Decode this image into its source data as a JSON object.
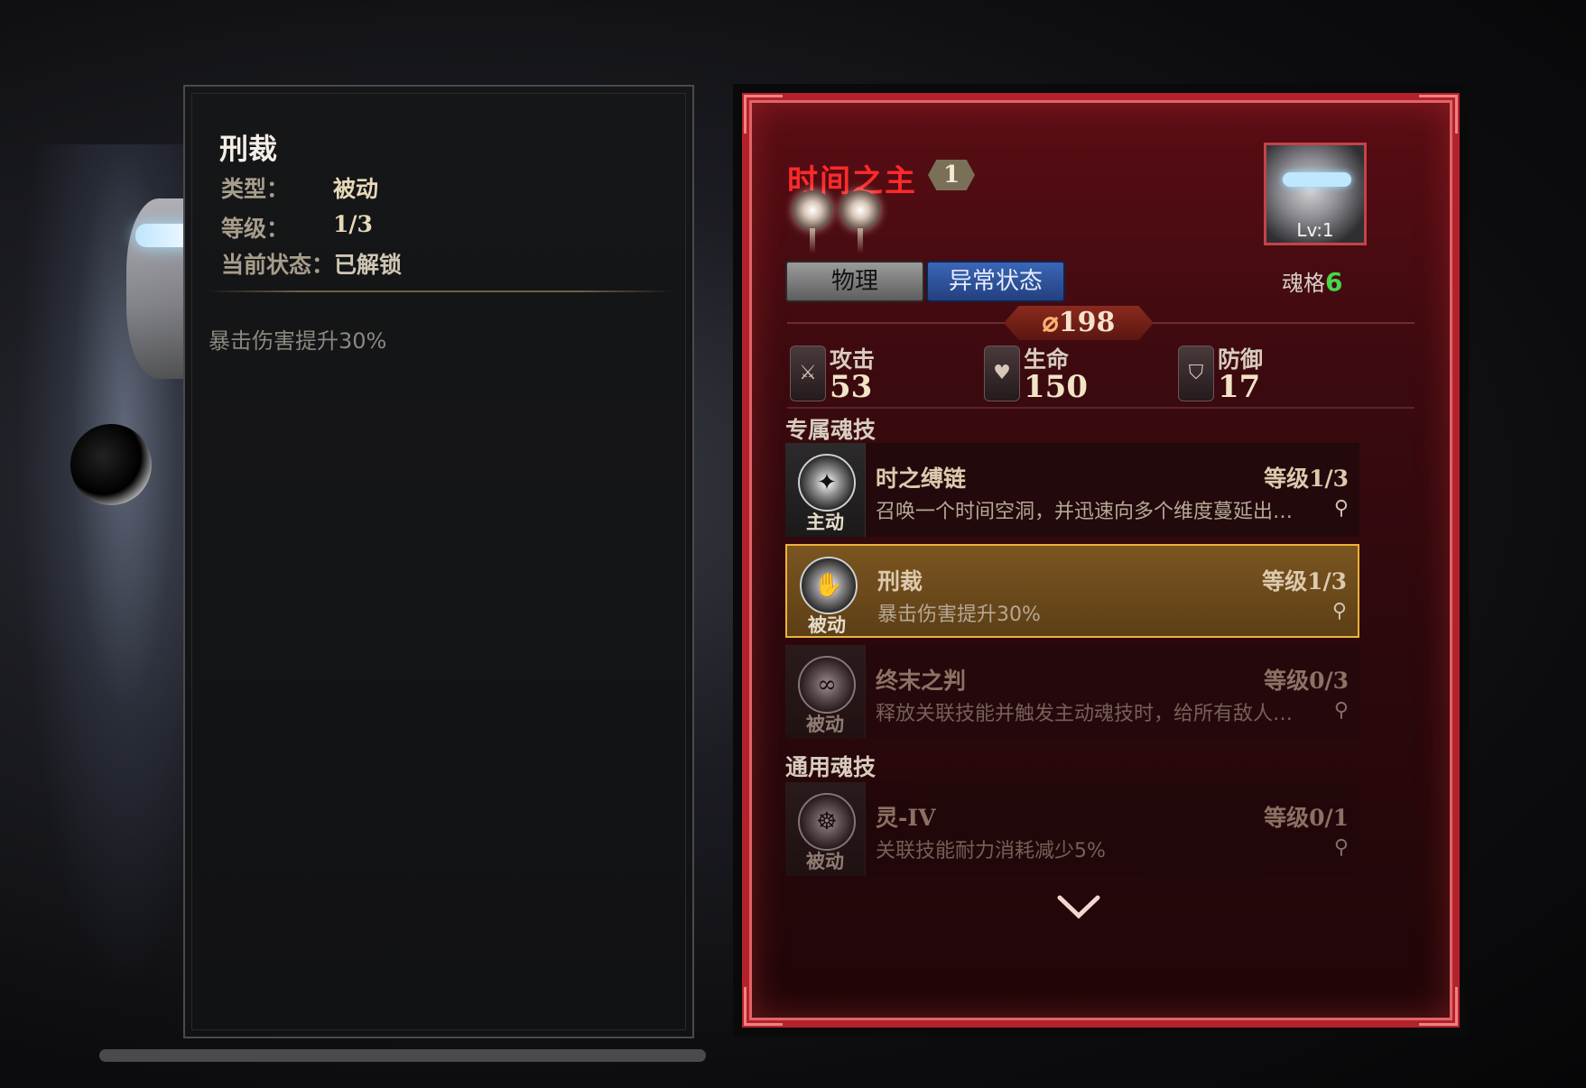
{
  "detail_panel": {
    "title": "刑裁",
    "type_label": "类型：",
    "type_value": "被动",
    "level_label": "等级：",
    "level_value": "1/3",
    "status_label": "当前状态：",
    "status_value": "已解锁",
    "description": "暴击伤害提升30%"
  },
  "hero": {
    "name": "时间之主",
    "rank": "1",
    "tags": [
      "物理",
      "异常状态"
    ],
    "portrait_level": "Lv:1",
    "soul_label": "魂格",
    "soul_value": "6",
    "power": "198",
    "stats": [
      {
        "label": "攻击",
        "value": "53",
        "icon": "sword-icon"
      },
      {
        "label": "生命",
        "value": "150",
        "icon": "heart-icon"
      },
      {
        "label": "防御",
        "value": "17",
        "icon": "shield-icon"
      }
    ]
  },
  "sections": {
    "exclusive": "专属魂技",
    "general": "通用魂技"
  },
  "skills": [
    {
      "name": "时之缚链",
      "type": "主动",
      "level": "等级1/3",
      "desc": "召唤一个时间空洞，并迅速向多个维度蔓延出…",
      "icon": "wing-icon"
    },
    {
      "name": "刑裁",
      "type": "被动",
      "level": "等级1/3",
      "desc": "暴击伤害提升30%",
      "icon": "hand-icon"
    },
    {
      "name": "终末之判",
      "type": "被动",
      "level": "等级0/3",
      "desc": "释放关联技能并触发主动魂技时，给所有敌人…",
      "icon": "infinity-icon"
    },
    {
      "name": "灵-IV",
      "type": "被动",
      "level": "等级0/1",
      "desc": "关联技能耐力消耗减少5%",
      "icon": "spirit-icon"
    }
  ],
  "colors": {
    "accent_red": "#b3222c",
    "selected_gold": "#f0b23a",
    "soul_green": "#46d84a"
  }
}
